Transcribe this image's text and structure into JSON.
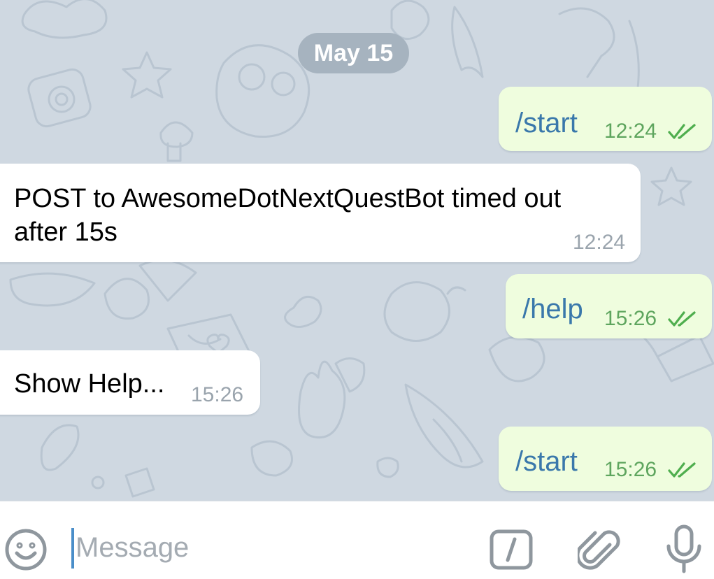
{
  "chat": {
    "date_label": "May 15",
    "messages": [
      {
        "direction": "out",
        "text": "/start",
        "time": "12:24",
        "status": "read"
      },
      {
        "direction": "in",
        "text_line1": "POST to AwesomeDotNextQuestBot timed out",
        "text_line2": "after 15s",
        "time": "12:24"
      },
      {
        "direction": "out",
        "text": "/help",
        "time": "15:26",
        "status": "read"
      },
      {
        "direction": "in",
        "text": "Show Help...",
        "time": "15:26"
      },
      {
        "direction": "out",
        "text": "/start",
        "time": "15:26",
        "status": "read"
      }
    ]
  },
  "input_bar": {
    "placeholder": "Message",
    "value": "",
    "icons": {
      "emoji": "smiley-icon",
      "commands": "slash-command-icon",
      "attach": "paperclip-icon",
      "voice": "microphone-icon"
    }
  },
  "colors": {
    "chat_background": "#cfd8e1",
    "outgoing_bubble": "#effdde",
    "incoming_bubble": "#ffffff",
    "command_text": "#3a78ab",
    "outgoing_time": "#5ea55e",
    "incoming_time": "#9aa4ad",
    "date_pill": "#a6b3bf"
  }
}
